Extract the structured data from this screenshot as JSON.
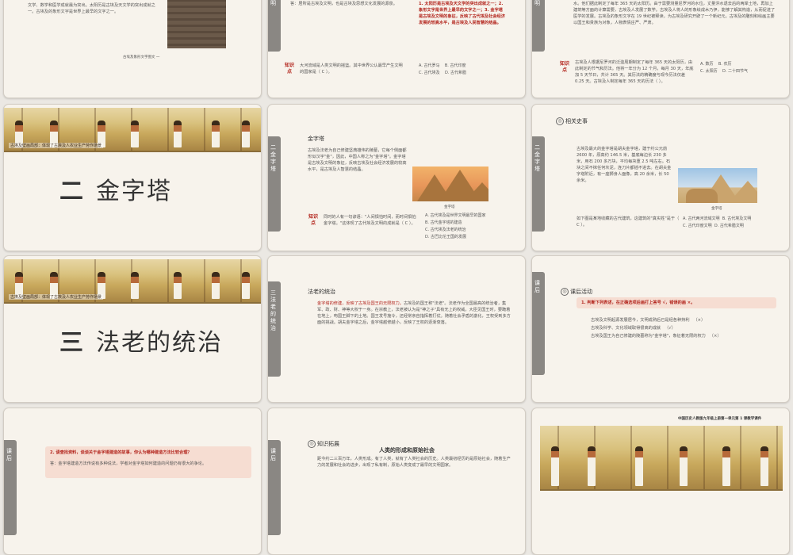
{
  "slides": {
    "s1": {
      "body": "文学、数学和医学成就最为突出。太阳历是古埃及天文学的突出成就之一。古埃及的象形文字是世界上最早的文字之一。",
      "caption": "古埃及象形文字图文 一"
    },
    "s2": {
      "text_top": "答：居所是古埃及文明，也是古埃及思想文化发展的源泉。",
      "red_notes": "1. 太阳历是古埃及天文学的突出成就之一；2. 象形文字是世界上最早的文字之一；3. 金字塔是古埃及文明的象征，反映了古代埃及社会经济发展的较高水平，是古埃及人民智慧的结晶。",
      "q_label": "知识点",
      "q_text": "大河流域是人类文明的摇篮。其中世界公认最早产生文明的国家是（ C ）。",
      "options": [
        "A. 古代罗马",
        "B. 古代印度",
        "C. 古代埃及",
        "D. 古代希腊"
      ]
    },
    "s3": {
      "text_top": "水。他们据此制定了每年 365 天的太阳历。由于需要测量尼罗河的水位，丈量洪水退去后的两岸土地，再加上建筑等方面的计算需要，古埃及人发展了数学。古埃及人将人的形象绘成木乃伊，能够了解其构造，从而促进了医学的发展。古埃及的象形文字在 19 世纪被释读，为古埃及研究开辟了一个新纪元。古埃及的雕刻和绘画主要以国王和贵族为对象，人物表情庄严、严肃。",
      "q_label": "知识点",
      "q_text": "古埃及人根据尼罗河的泛滥周期制定了每年 365 天的太阳历，由此制定的节气和历法。他将一年分为 12 个月，每月 30 天，年底加 5 天节日，共计 365 天。其历法的精确度与现今历法仅差 0.25 天。古埃及人制定每年 365 天的历法（ ）。",
      "options": [
        "A. 数历",
        "B. 农历",
        "C. 太阳历",
        "D. 二十四节气"
      ]
    },
    "s4": {
      "mural_caption": "古埃及壁画局部：体现了古埃及人农业生产劳作场景",
      "number": "二",
      "title": "金字塔",
      "tab": "二 金字塔"
    },
    "s5": {
      "heading": "金字塔",
      "body": "古埃及法老为自己修建坚典雄伟的陵墓，它每个侧面都形似汉字\"金\"，因此，中国人称之为\"金字塔\"。金字塔是古埃及文明的象征，反映古埃及社会经济发展的较高水平，是古埃及人智慧的结晶。",
      "image_caption": "金字塔",
      "q_label": "知识点",
      "q_text": "同时的人有一句谚语：\"人间惧怕时间，而时间惧怕金字塔。\"这体现了古代埃及文明的成就是（ C ）。",
      "options": [
        "A. 古代埃及是世界文明最早的国家",
        "B. 古代金字塔的建造",
        "C. 古代埃及法老的统治",
        "D. 古巴比伦王国的发展"
      ]
    },
    "s6": {
      "tab": "二 金字塔",
      "heading": "相关史事",
      "body": "古埃及最大的金字塔是胡夫金字塔，建于约公元前 2600 年，原高约 146.5 米，基底每边长 230 多米，用石 200 多万块，平均每块重 2.5 吨左右。石块之间不抹任何灰泥，连刀片都插不进去。在胡夫金字塔附近，有一座狮身人面像，高 20 余米，长 50 余米。",
      "image_caption": "金字塔",
      "q_text": "如下图是某地收藏的古代建筑，这建筑的\"真实姓\"是于（ C ）。",
      "options": [
        "A. 古代两河流域文明",
        "B. 古代埃及文明",
        "C. 古代印度文明",
        "D. 古代希腊文明"
      ]
    },
    "s7": {
      "mural_caption": "古埃及壁画局部：体现了古埃及人农业生产劳作场景",
      "number": "三",
      "title": "法老的统治"
    },
    "s8": {
      "tab": "三 法老的统治",
      "heading": "法老的统治",
      "body_red": "金字塔的修建，反映了古埃及国王的无限权力。",
      "body": "古埃及的国王称\"法老\"。法老作为全国最高的统治者，集军、政、财、神等大权于一身。在宗教上，法老被认为是\"神之子\"具有无上的权威。大臣见国王时，要跪着在地上，吻国王脚下的土地。国王发号施令，还经常亲自指挥着打仗。随着社会矛盾的激化，王权受到多方面的挑战。胡夫金字塔之后，金字塔越修越小，反映了王权的逐渐衰落。"
    },
    "s9": {
      "tab": "课后",
      "heading": "课后活动",
      "instruction": "1. 判断下列表述，在正确选项后画打上答号 √，错误的画 ×。",
      "statements": [
        {
          "text": "古埃及文明起源发展居今，文明成熟后已是经各种持利",
          "mark": "（×）"
        },
        {
          "text": "古埃及科学、文化领域取得很高的成就",
          "mark": "（√）"
        },
        {
          "text": "古埃及国王为自己修建的陵墓称为\"金字塔\"，象征着无限的权力",
          "mark": "（×）"
        }
      ]
    },
    "s10": {
      "tab": "课后",
      "question": "2. 请查找资料，谈谈关于金字塔建造的故事，你认为哪种建造方法比较合理？",
      "answer": "答：金字塔建造方法传说有多种说法，学者对金字塔如何建造的问题仍有很大的争论。"
    },
    "s11": {
      "tab": "课后",
      "heading": "知识拓展",
      "subheading": "人类的形成和原始社会",
      "body": "距今约二三百万年，人类形成。有了人类，就有了人类社会的历史。人类最初经历的是原始社会，随着生产力的发展和社会的进步，出现了私有制，原始人类变成了最早的文明国家。"
    },
    "s12": {
      "header": "中国历史人教版九年级上册第一单元第 1 课教学课件"
    }
  },
  "colors": {
    "accent_red": "#b3261e",
    "tab_gray": "#8a8783",
    "slide_bg": "#f7f3ec"
  }
}
